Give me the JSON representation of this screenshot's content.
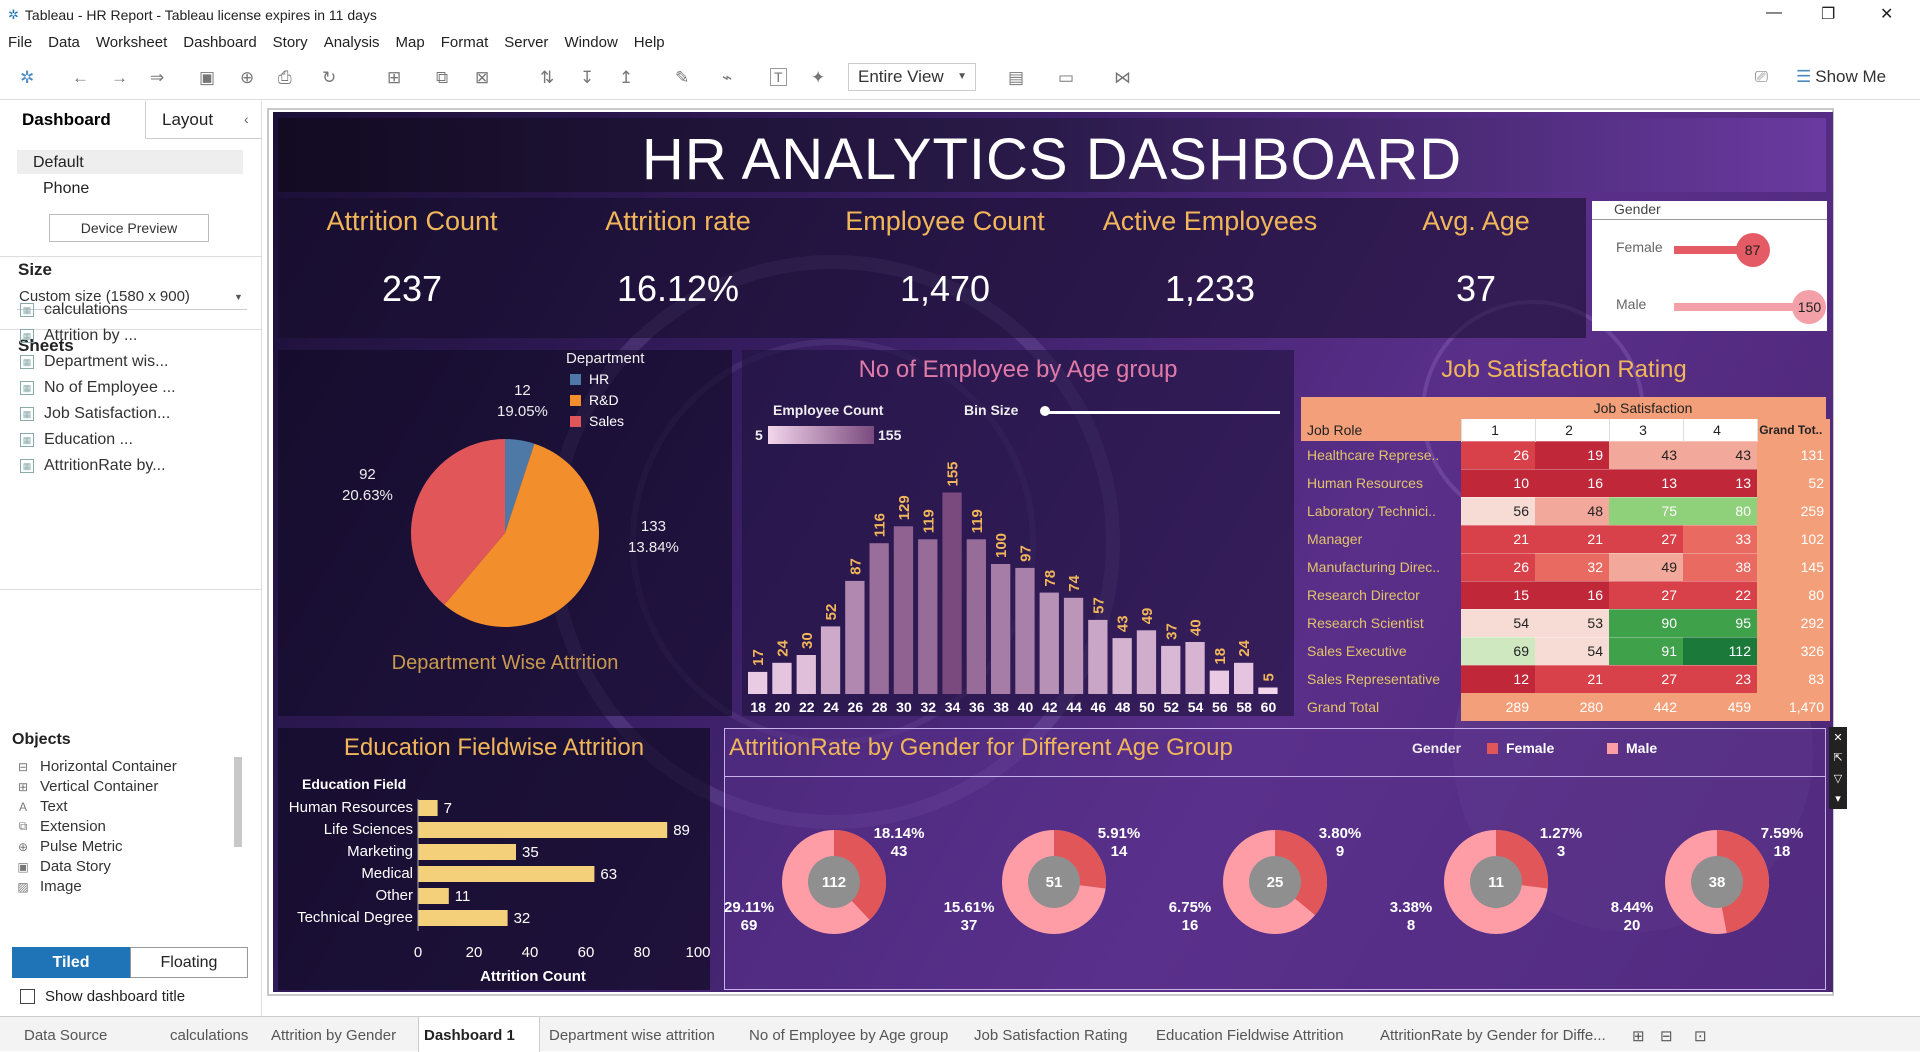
{
  "window": {
    "title": "Tableau - HR Report - Tableau license expires in 11 days"
  },
  "menu": [
    "File",
    "Data",
    "Worksheet",
    "Dashboard",
    "Story",
    "Analysis",
    "Map",
    "Format",
    "Server",
    "Window",
    "Help"
  ],
  "toolbar": {
    "fit": "Entire View",
    "show_me": "Show Me"
  },
  "left": {
    "tab_dashboard": "Dashboard",
    "tab_layout": "Layout",
    "device_default": "Default",
    "device_phone": "Phone",
    "device_preview": "Device Preview",
    "size_title": "Size",
    "size_value": "Custom size (1580 x 900)",
    "sheets_title": "Sheets",
    "sheets": [
      "calculations",
      "Attrition by ...",
      "Department wis...",
      "No of Employee ...",
      "Job Satisfaction...",
      "Education ...",
      "AttritionRate by..."
    ],
    "objects_title": "Objects",
    "objects": [
      "Horizontal Container",
      "Vertical Container",
      "Text",
      "Extension",
      "Pulse Metric",
      "Data Story",
      "Image"
    ],
    "tiled": "Tiled",
    "floating": "Floating",
    "show_title": "Show dashboard title"
  },
  "tabs": [
    "Data Source",
    "calculations",
    "Attrition by Gender",
    "Dashboard 1",
    "Department wise attrition",
    "No of Employee by Age group",
    "Job Satisfaction Rating",
    "Education Fieldwise Attrition",
    "AttritionRate by Gender for Diffe..."
  ],
  "dashboard": {
    "title": "HR ANALYTICS DASHBOARD",
    "kpis": [
      {
        "label": "Attrition Count",
        "value": "237"
      },
      {
        "label": "Attrition rate",
        "value": "16.12%"
      },
      {
        "label": "Employee Count",
        "value": "1,470"
      },
      {
        "label": "Active Employees",
        "value": "1,233"
      },
      {
        "label": "Avg. Age",
        "value": "37"
      }
    ],
    "gender": {
      "title": "Gender",
      "female_label": "Female",
      "female": 87,
      "male_label": "Male",
      "male": 150
    },
    "dept": {
      "legend_title": "Department",
      "title": "Department Wise Attrition",
      "slices": [
        {
          "name": "HR",
          "count": "12",
          "pct": "19.05%",
          "value": 12,
          "color": "#4e79a7"
        },
        {
          "name": "R&D",
          "count": "133",
          "pct": "13.84%",
          "value": 133,
          "color": "#f28e2b"
        },
        {
          "name": "Sales",
          "count": "92",
          "pct": "20.63%",
          "value": 92,
          "color": "#e15759"
        }
      ]
    },
    "age": {
      "title": "No of Employee by Age group",
      "legend_title": "Employee Count",
      "legend_min": "5",
      "legend_max": "155",
      "bin_label": "Bin Size"
    },
    "job": {
      "title": "Job Satisfaction Rating",
      "col_title": "Job Satisfaction",
      "role_header": "Job Role",
      "cols": [
        "1",
        "2",
        "3",
        "4",
        "Grand Tot.."
      ],
      "rows": [
        {
          "role": "Healthcare Represe..",
          "v": [
            26,
            19,
            43,
            43
          ],
          "total": "131"
        },
        {
          "role": "Human Resources",
          "v": [
            10,
            16,
            13,
            13
          ],
          "total": "52"
        },
        {
          "role": "Laboratory Technici..",
          "v": [
            56,
            48,
            75,
            80
          ],
          "total": "259"
        },
        {
          "role": "Manager",
          "v": [
            21,
            21,
            27,
            33
          ],
          "total": "102"
        },
        {
          "role": "Manufacturing Direc..",
          "v": [
            26,
            32,
            49,
            38
          ],
          "total": "145"
        },
        {
          "role": "Research Director",
          "v": [
            15,
            16,
            27,
            22
          ],
          "total": "80"
        },
        {
          "role": "Research Scientist",
          "v": [
            54,
            53,
            90,
            95
          ],
          "total": "292"
        },
        {
          "role": "Sales Executive",
          "v": [
            69,
            54,
            91,
            112
          ],
          "total": "326"
        },
        {
          "role": "Sales Representative",
          "v": [
            12,
            21,
            27,
            23
          ],
          "total": "83"
        }
      ],
      "grand": {
        "role": "Grand Total",
        "v": [
          "289",
          "280",
          "442",
          "459"
        ],
        "total": "1,470"
      }
    },
    "edu": {
      "title": "Education Fieldwise Attrition",
      "axis_title": "Education Field",
      "xlabel": "Attrition Count"
    },
    "gage": {
      "title": "AttritionRate by Gender for Different Age Group",
      "legend_title": "Gender",
      "female_label": "Female",
      "male_label": "Male",
      "female_color": "#e15759",
      "male_color": "#ff9da7",
      "donuts": [
        {
          "center": "112",
          "female_pct": "18.14%",
          "female_n": "43",
          "male_pct": "29.11%",
          "male_n": "69",
          "female_share": 0.38
        },
        {
          "center": "51",
          "female_pct": "5.91%",
          "female_n": "14",
          "male_pct": "15.61%",
          "male_n": "37",
          "female_share": 0.27
        },
        {
          "center": "25",
          "female_pct": "3.80%",
          "female_n": "9",
          "male_pct": "6.75%",
          "male_n": "16",
          "female_share": 0.36
        },
        {
          "center": "11",
          "female_pct": "1.27%",
          "female_n": "3",
          "male_pct": "3.38%",
          "male_n": "8",
          "female_share": 0.27
        },
        {
          "center": "38",
          "female_pct": "7.59%",
          "female_n": "18",
          "male_pct": "8.44%",
          "male_n": "20",
          "female_share": 0.47
        }
      ]
    }
  },
  "chart_data": [
    {
      "type": "bar",
      "title": "No of Employee by Age group",
      "categories": [
        "18",
        "20",
        "22",
        "24",
        "26",
        "28",
        "30",
        "32",
        "34",
        "36",
        "38",
        "40",
        "42",
        "44",
        "46",
        "48",
        "50",
        "52",
        "54",
        "56",
        "58",
        "60"
      ],
      "values": [
        17,
        24,
        30,
        52,
        87,
        116,
        129,
        119,
        155,
        119,
        100,
        97,
        78,
        74,
        57,
        43,
        49,
        37,
        40,
        18,
        24,
        5
      ],
      "ylim": [
        0,
        160
      ]
    },
    {
      "type": "bar",
      "title": "Education Fieldwise Attrition",
      "categories": [
        "Human Resources",
        "Life Sciences",
        "Marketing",
        "Medical",
        "Other",
        "Technical Degree"
      ],
      "values": [
        7,
        89,
        35,
        63,
        11,
        32
      ],
      "xticks": [
        "0",
        "20",
        "40",
        "60",
        "80",
        "100"
      ],
      "xlim": [
        0,
        100
      ],
      "xlabel": "Attrition Count",
      "ylabel": "Education Field"
    }
  ]
}
